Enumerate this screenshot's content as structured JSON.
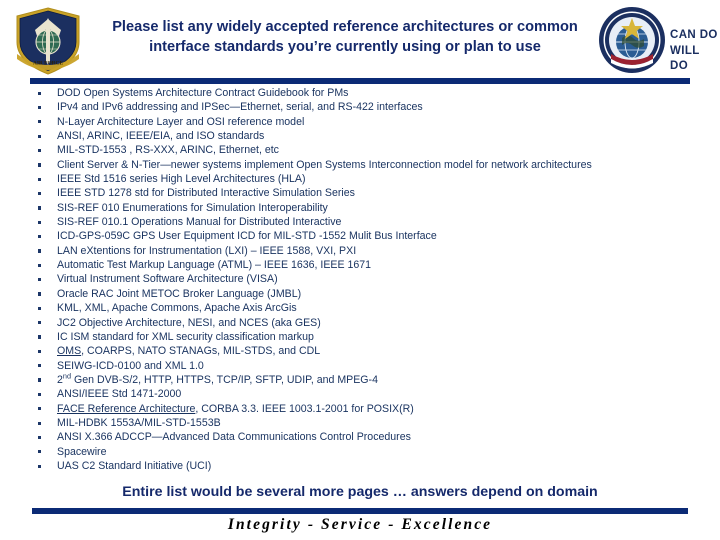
{
  "header": {
    "title": "Please list any widely accepted reference architectures  or common interface standards you’re currently using  or plan to use",
    "left_seal_name": "air-force-seal",
    "left_seal_banner": "AIR FORCE",
    "right_seal_name": "command-seal",
    "motto_line1": "CAN DO",
    "motto_line2": "WILL DO"
  },
  "colors": {
    "navy_rule": "#0b2a75",
    "title_text": "#15296b",
    "body_text": "#18325f",
    "seal_blue": "#1b2f60",
    "seal_gold": "#c9a227"
  },
  "bullets": [
    {
      "text": "DOD Open Systems Architecture Contract Guidebook for PMs"
    },
    {
      "text": "IPv4 and IPv6 addressing and IPSec—Ethernet, serial, and RS-422 interfaces"
    },
    {
      "text": "N-Layer Architecture Layer and OSI reference model"
    },
    {
      "text": "ANSI, ARINC, IEEE/EIA, and ISO standards"
    },
    {
      "text": "MIL-STD-1553 , RS-XXX, ARINC, Ethernet, etc"
    },
    {
      "text": "Client Server & N-Tier—newer systems implement Open Systems Interconnection model for network architectures"
    },
    {
      "text": "IEEE Std 1516 series High Level Architectures (HLA)"
    },
    {
      "text": "IEEE STD 1278 std for Distributed Interactive Simulation Series"
    },
    {
      "text": "SIS-REF 010 Enumerations for Simulation Interoperability"
    },
    {
      "text": "SIS-REF 010.1 Operations Manual for Distributed Interactive"
    },
    {
      "text": "ICD-GPS-059C GPS User Equipment ICD for MIL-STD -1552 Mulit Bus Interface"
    },
    {
      "text": "LAN eXtentions for Instrumentation (LXI) – IEEE 1588, VXI, PXI"
    },
    {
      "text": "Automatic Test Markup Language (ATML) – IEEE 1636, IEEE 1671"
    },
    {
      "text": "Virtual Instrument Software Architecture (VISA)"
    },
    {
      "text": "Oracle RAC Joint METOC Broker Language (JMBL)"
    },
    {
      "text": "KML, XML, Apache Commons, Apache Axis ArcGis"
    },
    {
      "text": "JC2 Objective Architecture, NESI, and NCES (aka GES)"
    },
    {
      "text": "IC ISM standard for XML security classification markup"
    },
    {
      "html": "<span class=\"und\">OMS</span>, COARPS, NATO STANAGs, MIL-STDS, and CDL"
    },
    {
      "text": "SEIWG-ICD-0100 and XML 1.0"
    },
    {
      "html": "2<sup>nd</sup> Gen DVB-S/2, HTTP, HTTPS, TCP/IP, SFTP, UDIP, and MPEG-4"
    },
    {
      "text": "ANSI/IEEE Std 1471-2000"
    },
    {
      "html": "<span class=\"und\">FACE Reference Architecture</span>, CORBA 3.3. IEEE 1003.1-2001 for POSIX(R)"
    },
    {
      "text": "MIL-HDBK 1553A/MIL-STD-1553B"
    },
    {
      "text": "ANSI X.366 ADCCP—Advanced Data Communications Control Procedures"
    },
    {
      "text": "Spacewire"
    },
    {
      "text": "UAS C2 Standard Initiative (UCI)"
    }
  ],
  "closing_line": "Entire list would be several more pages … answers depend on domain",
  "footer_motto": "Integrity - Service - Excellence"
}
